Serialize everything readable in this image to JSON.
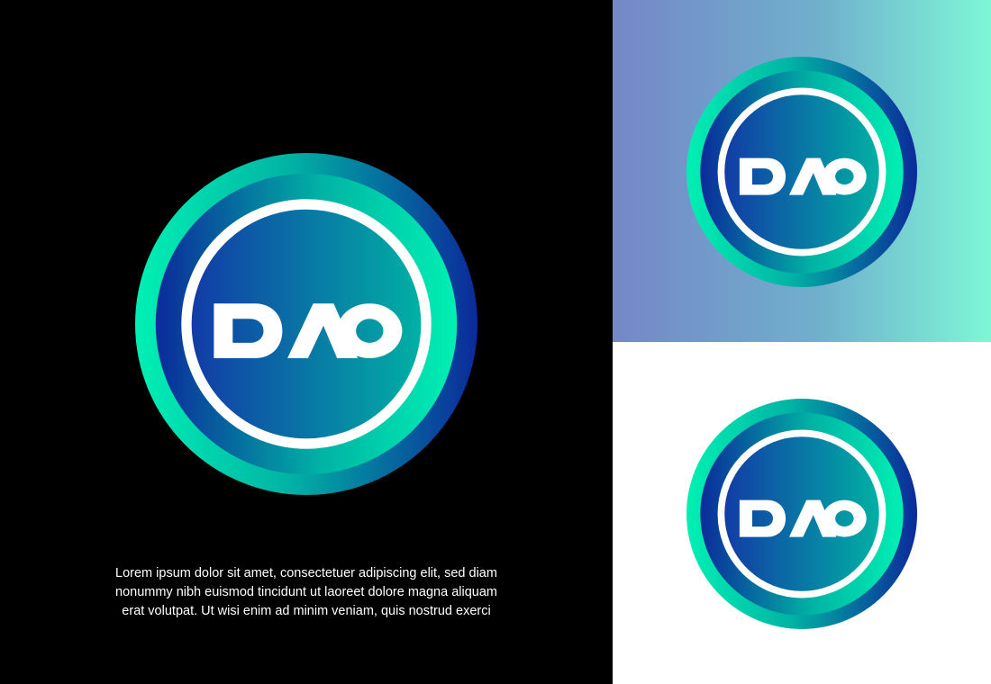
{
  "brand": {
    "wordmark": "DAO",
    "colors": {
      "navy": "#0b2a9a",
      "blue": "#1239a6",
      "teal": "#00b3a4",
      "mint": "#00f0b4",
      "white": "#ffffff",
      "black": "#000000"
    }
  },
  "caption": {
    "lines": [
      "Lorem ipsum dolor sit amet, consectetuer adipiscing elit, sed diam",
      "nonummy nibh euismod tincidunt ut laoreet dolore magna aliquam",
      "erat volutpat. Ut wisi enim ad minim veniam, quis nostrud exerci"
    ]
  }
}
